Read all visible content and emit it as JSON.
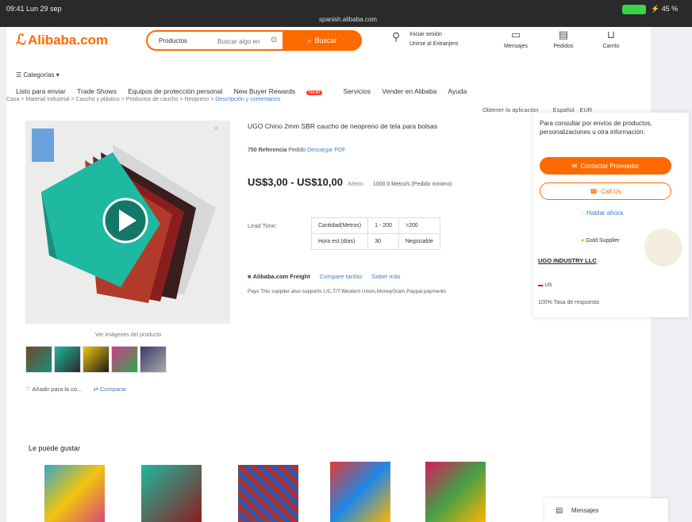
{
  "status": {
    "time": "09:41  Lun 29 sep",
    "url": "spanish.alibaba.com",
    "battery": "⚡ 45 %"
  },
  "header": {
    "logo": "Alibaba.com",
    "search": {
      "category": "Productos",
      "placeholder": "Buscar algo en",
      "button": "Buscar"
    },
    "account": {
      "line1": "Iniciar sesión",
      "line2": "Unirse al Extranjero"
    },
    "items": [
      {
        "label": "Mensajes"
      },
      {
        "label": "Pedidos"
      },
      {
        "label": "Carrito"
      }
    ]
  },
  "categories_label": "Categorías",
  "nav": [
    "Listo para enviar",
    "Trade Shows",
    "Equipos de protección personal",
    "New Buyer Rewards",
    "Servicios",
    "Vender en Alibaba",
    "Ayuda"
  ],
  "nav_badge": "NEW",
  "breadcrumb": {
    "path": "Casa > Material Industrial > Caucho y plástico > Productos de caucho > Neopreno > ",
    "last": "Descripción y comentarios"
  },
  "toprow": {
    "app": "Obtener la aplicación",
    "lang": "Español · EUR"
  },
  "product": {
    "title": "UGO Chino 2mm SBR caucho de neopreno de tela para bolsas",
    "ref_label": "750 Referencia",
    "ref_rating": "Pedido",
    "ref_link": "Descargar PDF",
    "price": "US$3,00 - US$10,00",
    "unit": "/Metro",
    "moq": "1000.0 Metro/s (Pedido mínimo)",
    "lead_label": "Lead Time:",
    "lead_table": [
      [
        "Cantidad(Metros)",
        "1 - 200",
        ">200"
      ],
      [
        "Hora est.(días)",
        "30",
        "Negociable"
      ]
    ],
    "freight": "Alibaba.com Freight",
    "freight_link1": "Compare tarifas",
    "freight_link2": "Saber más",
    "payments": "Pays   This supplier also supports L/C,T/T,Western Union,MoneyGram,Paypal payments",
    "video_indicator": "Ver imágenes del producto",
    "add_to_list": "Añadir para la co...",
    "compare": "Comparar"
  },
  "panel": {
    "desc": "Para consultar por envíos de productos, personalizaciones u otra información:",
    "contact": "Contactar Proveedor",
    "call": "Call Us",
    "chat": "Hablar ahora",
    "gold": "Gold Supplier",
    "supplier": "UGO INDUSTRY LLC",
    "country": "US",
    "response": "100% Tasa de respuesta"
  },
  "related": {
    "title": "Le puede gustar"
  },
  "messages_button": "Mensajes",
  "colors": {
    "brand": "#ff6a00",
    "link": "#3b7ec7"
  }
}
